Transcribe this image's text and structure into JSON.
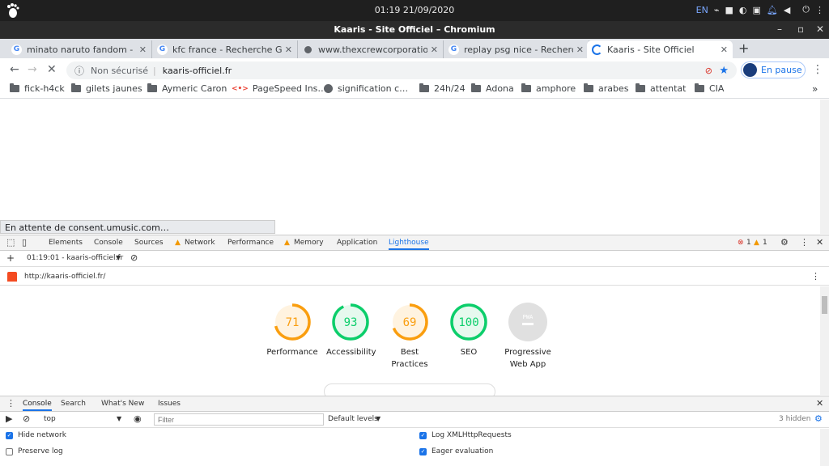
{
  "system": {
    "clock": "01:19 21/09/2020",
    "lang": "EN"
  },
  "window": {
    "title": "Kaaris - Site Officiel – Chromium"
  },
  "tabs": [
    {
      "label": "minato naruto fandom - R",
      "favicon": "google-icon"
    },
    {
      "label": "kfc france - Recherche Go",
      "favicon": "google-icon"
    },
    {
      "label": "www.thexcrewcorporation",
      "favicon": "globe-icon"
    },
    {
      "label": "replay psg nice - Recherch",
      "favicon": "google-icon"
    },
    {
      "label": "Kaaris - Site Officiel",
      "favicon": "loading-icon",
      "active": true
    }
  ],
  "toolbar": {
    "security_label": "Non sécurisé",
    "url": "kaaris-officiel.fr",
    "profile_label": "En pause"
  },
  "bookmarks": [
    {
      "label": "fick-h4ck",
      "icon": "folder-icon"
    },
    {
      "label": "gilets jaunes",
      "icon": "folder-icon"
    },
    {
      "label": "Aymeric Caron",
      "icon": "folder-icon"
    },
    {
      "label": "PageSpeed Ins…",
      "icon": "pagespeed-icon"
    },
    {
      "label": "signification c…",
      "icon": "globe-icon"
    },
    {
      "label": "24h/24",
      "icon": "folder-icon"
    },
    {
      "label": "Adona",
      "icon": "folder-icon"
    },
    {
      "label": "amphore",
      "icon": "folder-icon"
    },
    {
      "label": "arabes",
      "icon": "folder-icon"
    },
    {
      "label": "attentat",
      "icon": "folder-icon"
    },
    {
      "label": "CIA",
      "icon": "folder-icon"
    }
  ],
  "status_bar": "En attente de consent.umusic.com…",
  "devtools": {
    "tabs": [
      "Elements",
      "Console",
      "Sources",
      "Network",
      "Performance",
      "Memory",
      "Application",
      "Lighthouse"
    ],
    "selected_tab": "Lighthouse",
    "errors": "1",
    "warnings": "1",
    "report_select": "01:19:01 - kaaris-officiel.fr",
    "report_url": "http://kaaris-officiel.fr/",
    "scores": [
      {
        "label": "Performance",
        "value": "71",
        "color": "#fa9e0f",
        "fraction": 0.71
      },
      {
        "label": "Accessibility",
        "value": "93",
        "color": "#0cce6b",
        "fraction": 0.93
      },
      {
        "label": "Best Practices",
        "value": "69",
        "color": "#fa9e0f",
        "fraction": 0.69
      },
      {
        "label": "SEO",
        "value": "100",
        "color": "#0cce6b",
        "fraction": 1.0
      },
      {
        "label": "Progressive Web App",
        "value": "PWA",
        "color": "#9e9e9e",
        "fraction": 0
      }
    ]
  },
  "drawer": {
    "tabs": [
      "Console",
      "Search",
      "What's New",
      "Issues"
    ],
    "selected_tab": "Console",
    "context": "top",
    "filter_placeholder": "Filter",
    "levels": "Default levels",
    "hidden": "3 hidden",
    "options": [
      {
        "label": "Hide network",
        "checked": true
      },
      {
        "label": "Log XMLHttpRequests",
        "checked": true
      },
      {
        "label": "Preserve log",
        "checked": false
      },
      {
        "label": "Eager evaluation",
        "checked": true
      }
    ]
  }
}
